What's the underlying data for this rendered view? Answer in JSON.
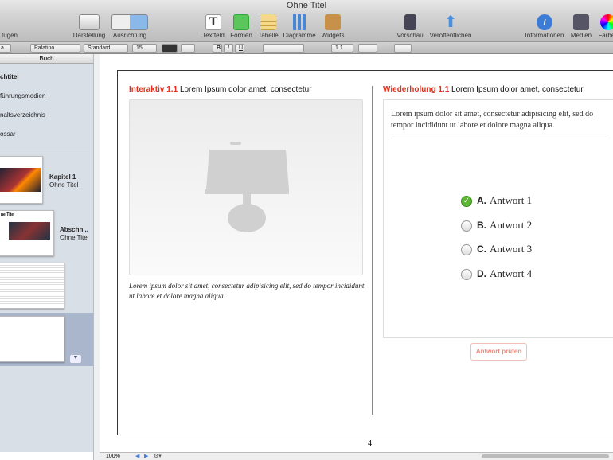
{
  "window": {
    "title": "Ohne Titel"
  },
  "toolbar": {
    "insert": "fügen",
    "view": "Darstellung",
    "orientation": "Ausrichtung",
    "textbox": "Textfeld",
    "shapes": "Formen",
    "table": "Tabelle",
    "charts": "Diagramme",
    "widgets": "Widgets",
    "preview": "Vorschau",
    "publish": "Veröffentlichen",
    "info": "Informationen",
    "media": "Medien",
    "colors": "Farben"
  },
  "formatbar": {
    "style": "a",
    "font": "Palatino",
    "typeface": "Standard",
    "size": "15",
    "bold": "B",
    "italic": "I",
    "underline": "U",
    "line_spacing": "1.1"
  },
  "sidebar": {
    "header": "Buch",
    "items": [
      "chtitel",
      "führungsmedien",
      "naltsverzeichnis",
      "ossar"
    ],
    "chapters": [
      {
        "title": "Kapitel 1",
        "subtitle": "Ohne Titel"
      },
      {
        "title": "Abschn...",
        "subtitle": "Ohne Titel"
      }
    ],
    "thumb_title": "ne Titel"
  },
  "page": {
    "left": {
      "label": "Interaktiv 1.1",
      "title": "Lorem Ipsum dolor amet, consectetur",
      "caption": "Lorem ipsum dolor sit amet, consectetur adipisicing elit, sed do tempor incididunt ut labore et dolore magna aliqua."
    },
    "right": {
      "label": "Wiederholung 1.1",
      "title": "Lorem Ipsum dolor amet, consectetur",
      "question": "Lorem ipsum dolor sit amet, consectetur adipisicing elit, sed do tempor incididunt ut labore et dolore magna aliqua.",
      "answers": [
        {
          "letter": "A.",
          "text": "Antwort 1",
          "checked": true
        },
        {
          "letter": "B.",
          "text": "Antwort 2",
          "checked": false
        },
        {
          "letter": "C.",
          "text": "Antwort 3",
          "checked": false
        },
        {
          "letter": "D.",
          "text": "Antwort 4",
          "checked": false
        }
      ],
      "check_button": "Antwort prüfen"
    },
    "number": "4"
  },
  "bottombar": {
    "zoom": "100%"
  },
  "colors": {
    "accent": "#e0301e"
  }
}
